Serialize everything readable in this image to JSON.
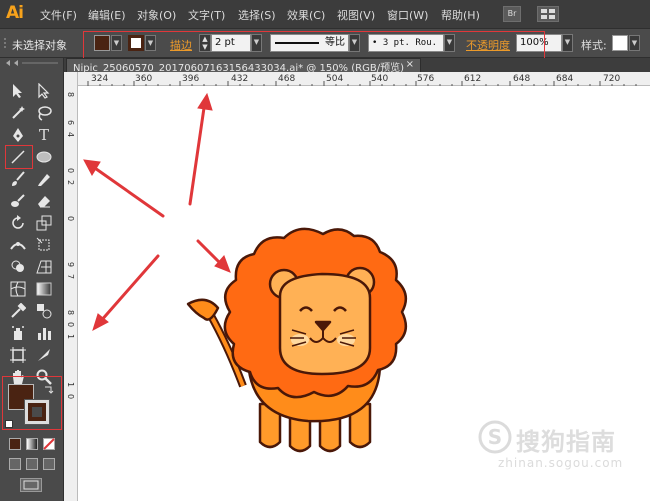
{
  "app": {
    "logo": "Ai"
  },
  "menu": {
    "items": [
      "文件(F)",
      "编辑(E)",
      "对象(O)",
      "文字(T)",
      "选择(S)",
      "效果(C)",
      "视图(V)",
      "窗口(W)",
      "帮助(H)"
    ],
    "bridge_label": "Br"
  },
  "control_bar": {
    "selection_status": "未选择对象",
    "fill_color": "#4a2312",
    "stroke_color": "#4a2312",
    "stroke_label": "描边",
    "stroke_weight": "2 pt",
    "profile_label": "等比",
    "brush_label": "3 pt. Rou.",
    "opacity_label": "不透明度",
    "opacity_value": "100%",
    "style_label": "样式:"
  },
  "document": {
    "tab_title": "Nipic_25060570_20170607163156433034.ai* @ 150% (RGB/预览)",
    "close_glyph": "×"
  },
  "rulers": {
    "horizontal": [
      "324",
      "360",
      "396",
      "432",
      "468",
      "504",
      "540",
      "576",
      "612",
      "648",
      "684",
      "720"
    ],
    "vertical": [
      "8",
      "6",
      "4",
      "0",
      "2",
      "0",
      "9",
      "7",
      "8",
      "0",
      "1",
      "1",
      "0"
    ]
  },
  "tools": [
    "selection-tool",
    "direct-selection-tool",
    "magic-wand-tool",
    "lasso-tool",
    "pen-tool",
    "type-tool",
    "line-segment-tool",
    "ellipse-tool",
    "paintbrush-tool",
    "pencil-tool",
    "blob-brush-tool",
    "eraser-tool",
    "rotate-tool",
    "scale-tool",
    "width-tool",
    "free-transform-tool",
    "shape-builder-tool",
    "perspective-grid-tool",
    "mesh-tool",
    "gradient-tool",
    "eyedropper-tool",
    "blend-tool",
    "symbol-sprayer-tool",
    "column-graph-tool",
    "artboard-tool",
    "slice-tool",
    "hand-tool",
    "zoom-tool"
  ],
  "toolbox_colors": {
    "fill": "#4a2312",
    "stroke": "#4a2312"
  },
  "accent_colors": {
    "highlight_red": "#e0373a",
    "ai_orange": "#f7a21b",
    "lion_mane": "#ff6a13",
    "lion_body": "#ff8c1a",
    "lion_face": "#ffb155"
  },
  "watermark": {
    "text": "搜狗指南",
    "url": "zhinan.sogou.com"
  }
}
